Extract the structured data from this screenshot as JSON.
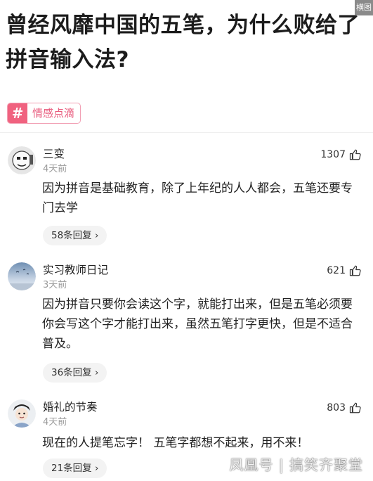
{
  "article": {
    "title": "曾经风靡中国的五笔，为什么败给了拼音输入法?",
    "corner_tag": "横图"
  },
  "topic_tag": {
    "icon": "#",
    "label": "情感点滴"
  },
  "comments": [
    {
      "user": "三变",
      "time": "4天前",
      "likes": "1307",
      "text": "因为拼音是基础教育，除了上年纪的人人都会，五笔还要专门去学",
      "replies": "58条回复 ›"
    },
    {
      "user": "实习教师日记",
      "time": "3天前",
      "likes": "621",
      "text": "因为拼音只要你会读这个字，就能打出来，但是五笔必须要你会写这个字才能打出来，虽然五笔打字更快，但是不适合普及。",
      "replies": "36条回复 ›"
    },
    {
      "user": "婚礼的节奏",
      "time": "4天前",
      "likes": "803",
      "text": "现在的人提笔忘字！ 五笔字都想不起来，用不来！",
      "replies": "21条回复 ›"
    }
  ],
  "watermark": "凤凰号 | 搞笑齐聚堂",
  "colors": {
    "accent": "#f0627f",
    "tag_text": "#e85a7c",
    "muted": "#9a9a9a"
  },
  "icons": {
    "like": "thumbs-up-icon",
    "tag": "hashtag-icon"
  }
}
